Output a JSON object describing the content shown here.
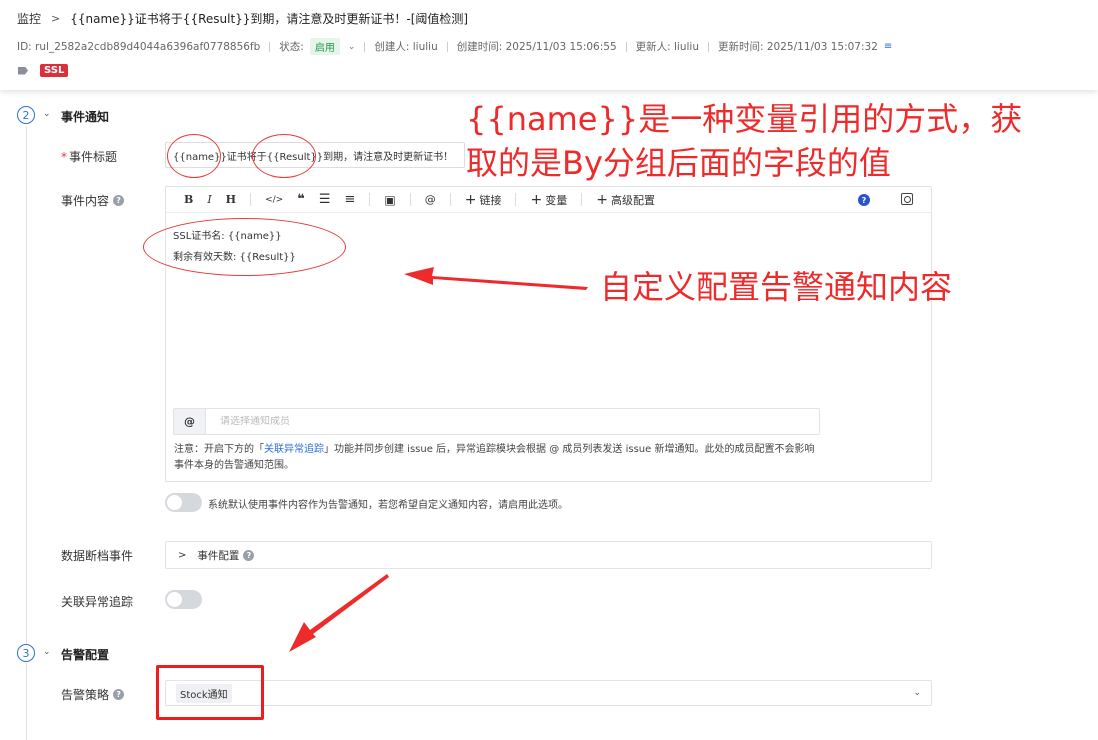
{
  "header": {
    "breadcrumb_root": "监控",
    "breadcrumb_title": "{{name}}证书将于{{Result}}到期，请注意及时更新证书！-[阈值检测]",
    "id_text": "ID: rul_2582a2cdb89d4044a6396af0778856fb",
    "status_label": "状态:",
    "status_value": "启用",
    "creator": "创建人: liuliu",
    "created_time": "创建时间: 2025/11/03 15:06:55",
    "updater": "更新人: liuliu",
    "updated_time": "更新时间: 2025/11/03 15:07:32",
    "tag": "SSL"
  },
  "section2": {
    "step": "2",
    "title": "事件通知",
    "event_title_label": "事件标题",
    "event_title_value": "{{name}}证书将于{{Result}}到期，请注意及时更新证书！",
    "event_content_label": "事件内容",
    "toolbar": {
      "bold": "B",
      "italic": "I",
      "heading": "H",
      "code": "</>",
      "quote": "❝",
      "at": "@",
      "link": "链接",
      "variable": "变量",
      "advanced": "高级配置",
      "help": "?"
    },
    "content_line1": "SSL证书名: {{name}}",
    "content_line2": "剩余有效天数: {{Result}}",
    "member_at": "@",
    "member_placeholder": "请选择通知成员",
    "note_prefix": "注意：开启下方的「",
    "note_link": "关联异常追踪",
    "note_suffix": "」功能并同步创建 issue 后，异常追踪模块会根据 @ 成员列表发送 issue 新增通知。此处的成员配置不会影响事件本身的告警通知范围。",
    "toggle_text": "系统默认使用事件内容作为告警通知，若您希望自定义通知内容，请启用此选项。",
    "archive_label": "数据断档事件",
    "archive_collapse": "事件配置",
    "issue_label": "关联异常追踪"
  },
  "section3": {
    "step": "3",
    "title": "告警配置",
    "policy_label": "告警策略",
    "policy_value": "Stock通知"
  },
  "annotations": {
    "line1": "{{name}}是一种变量引用的方式，获",
    "line2": "取的是By分组后面的字段的值",
    "content_note": "自定义配置告警通知内容",
    "color": "#ee2b2b"
  }
}
